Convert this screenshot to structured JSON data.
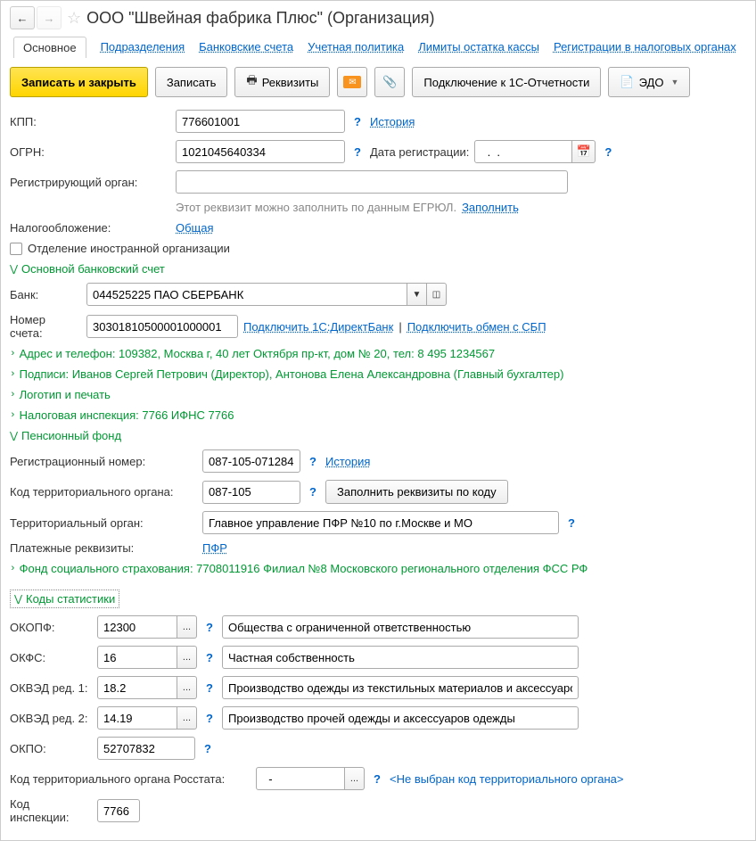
{
  "header": {
    "title": "ООО \"Швейная фабрика Плюс\" (Организация)"
  },
  "tabs": {
    "main": "Основное",
    "divisions": "Подразделения",
    "bank_accounts": "Банковские счета",
    "accounting_policy": "Учетная политика",
    "cash_limits": "Лимиты остатка кассы",
    "tax_registrations": "Регистрации в налоговых органах"
  },
  "toolbar": {
    "save_close": "Записать и закрыть",
    "save": "Записать",
    "requisites": "Реквизиты",
    "connect_1c": "Подключение к 1С-Отчетности",
    "edo": "ЭДО"
  },
  "fields": {
    "kpp_label": "КПП:",
    "kpp_value": "776601001",
    "history": "История",
    "ogrn_label": "ОГРН:",
    "ogrn_value": "1021045640334",
    "reg_date_label": "Дата регистрации:",
    "reg_date_value": "  .  .    ",
    "reg_org_label": "Регистрирующий орган:",
    "reg_org_value": "",
    "reg_hint": "Этот реквизит можно заполнить по данным ЕГРЮЛ.",
    "fill_link": "Заполнить",
    "taxation_label": "Налогообложение:",
    "taxation_link": "Общая",
    "foreign_branch": "Отделение иностранной организации"
  },
  "sections": {
    "bank_account": "Основной банковский счет",
    "address": "Адрес и телефон: 109382, Москва г, 40 лет Октября пр-кт, дом № 20, тел: 8 495 1234567",
    "signatures": "Подписи: Иванов Сергей Петрович (Директор), Антонова Елена Александровна (Главный бухгалтер)",
    "logo": "Логотип и печать",
    "tax_inspection": "Налоговая инспекция: 7766 ИФНС 7766",
    "pension_fund": "Пенсионный фонд",
    "social_insurance": "Фонд социального страхования: 7708011916 Филиал №8 Московского регионального отделения ФСС РФ",
    "stat_codes": "Коды статистики"
  },
  "bank": {
    "bank_label": "Банк:",
    "bank_value": "044525225 ПАО СБЕРБАНК",
    "account_label": "Номер счета:",
    "account_value": "30301810500001000001",
    "connect_directbank": "Подключить 1С:ДиректБанк",
    "connect_sbp": "Подключить обмен с СБП"
  },
  "pension": {
    "reg_num_label": "Регистрационный номер:",
    "reg_num_value": "087-105-071284",
    "territory_code_label": "Код территориального органа:",
    "territory_code_value": "087-105",
    "fill_by_code": "Заполнить реквизиты по коду",
    "territory_org_label": "Территориальный орган:",
    "territory_org_value": "Главное управление ПФР №10 по г.Москве и МО",
    "payment_label": "Платежные реквизиты:",
    "payment_link": "ПФР"
  },
  "stats": {
    "okopf_label": "ОКОПФ:",
    "okopf_code": "12300",
    "okopf_name": "Общества с ограниченной ответственностью",
    "okfs_label": "ОКФС:",
    "okfs_code": "16",
    "okfs_name": "Частная собственность",
    "okved1_label": "ОКВЭД ред. 1:",
    "okved1_code": "18.2",
    "okved1_name": "Производство одежды из текстильных материалов и аксессуаров о",
    "okved2_label": "ОКВЭД ред. 2:",
    "okved2_code": "14.19",
    "okved2_name": "Производство прочей одежды и аксессуаров одежды",
    "okpo_label": "ОКПО:",
    "okpo_value": "52707832",
    "rosstat_code_label": "Код территориального органа Росстата:",
    "rosstat_code_value": "  -",
    "rosstat_hint": "<Не выбран код территориального органа>",
    "inspection_code_label": "Код инспекции:",
    "inspection_code_value": "7766"
  }
}
